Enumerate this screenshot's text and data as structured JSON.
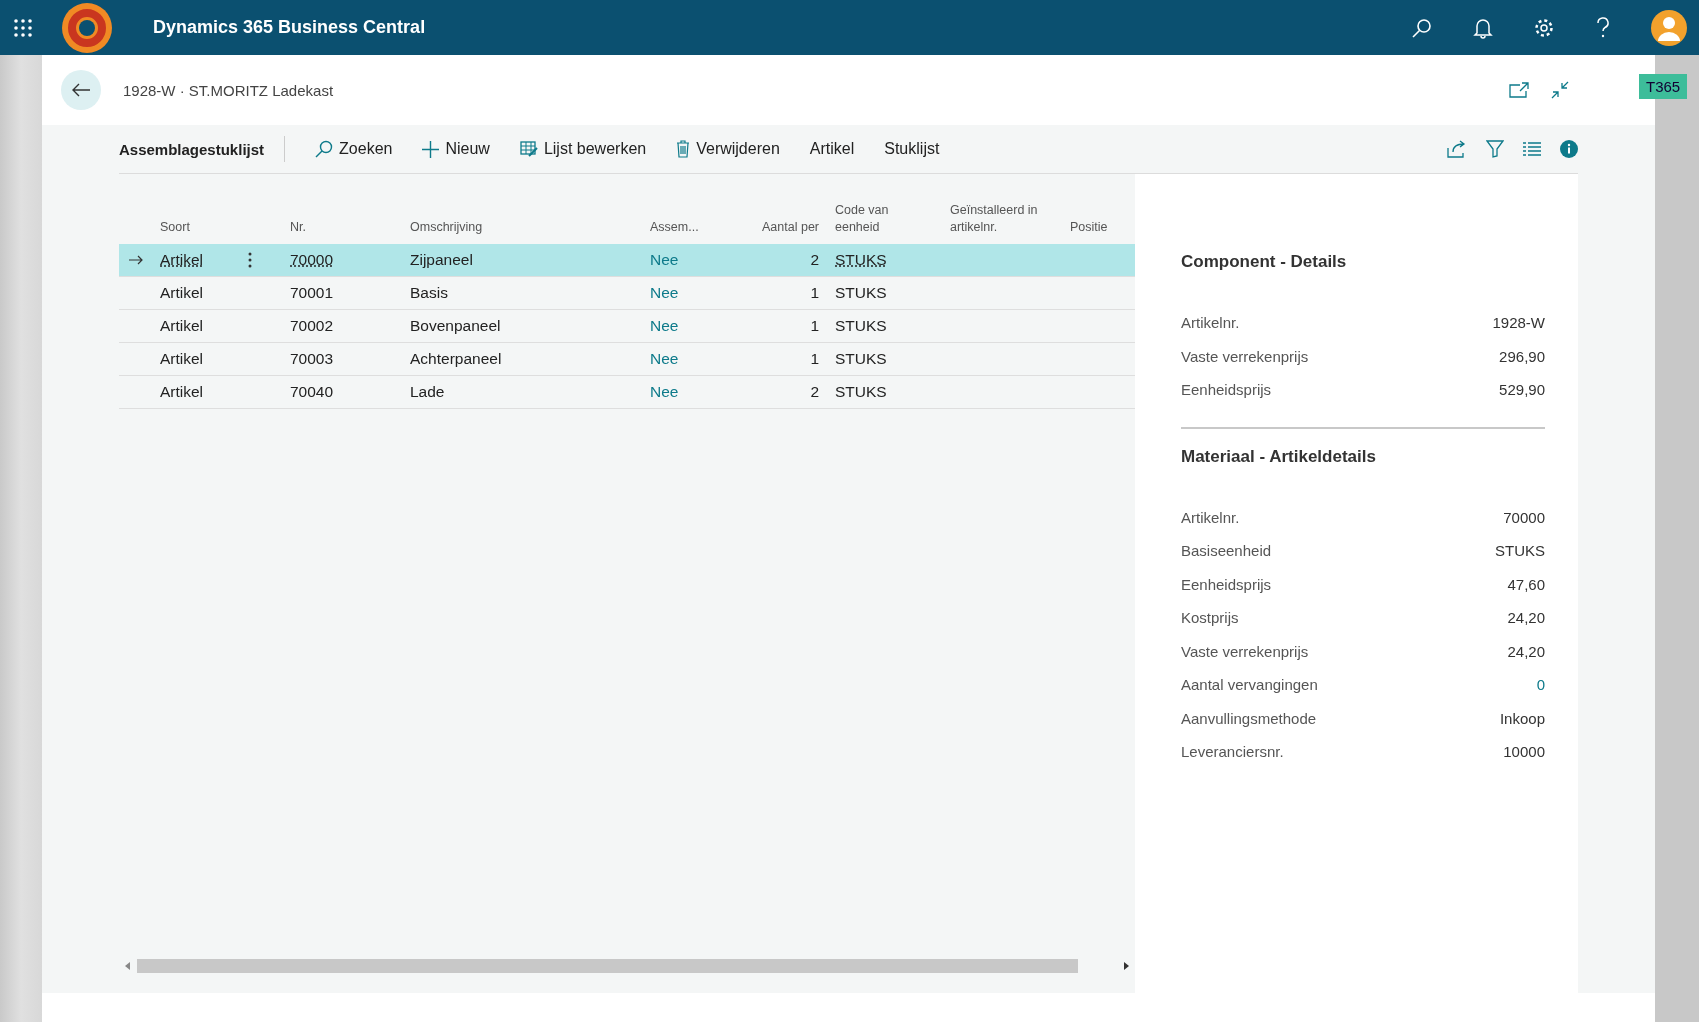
{
  "app": {
    "title": "Dynamics 365 Business Central"
  },
  "page": {
    "title": "1928-W · ST.MORITZ Ladekast"
  },
  "badge": "T365",
  "actions": [
    {
      "kind": "title",
      "label": "Assemblagestuklijst"
    },
    {
      "kind": "search",
      "label": "Zoeken"
    },
    {
      "kind": "new",
      "label": "Nieuw"
    },
    {
      "kind": "edit",
      "label": "Lijst bewerken"
    },
    {
      "kind": "delete",
      "label": "Verwijderen"
    },
    {
      "kind": "plain",
      "label": "Artikel"
    },
    {
      "kind": "plain",
      "label": "Stuklijst"
    }
  ],
  "table": {
    "columns": [
      {
        "label": "Soort",
        "kind": "lookup"
      },
      {
        "label": "Nr.",
        "kind": "lookup"
      },
      {
        "label": "Omschrijving",
        "kind": "text"
      },
      {
        "label": "Assem...",
        "kind": "flag"
      },
      {
        "label": "Aantal per",
        "kind": "number"
      },
      {
        "label": "Code van eenheid",
        "kind": "lookup"
      },
      {
        "label": "Geïnstalleerd in artikelnr.",
        "kind": "text"
      },
      {
        "label": "Positie",
        "kind": "text"
      }
    ],
    "rows": [
      {
        "selected": true,
        "cells": [
          "Artikel",
          "70000",
          "Zijpaneel",
          "Nee",
          "2",
          "STUKS",
          "",
          ""
        ]
      },
      {
        "selected": false,
        "cells": [
          "Artikel",
          "70001",
          "Basis",
          "Nee",
          "1",
          "STUKS",
          "",
          ""
        ]
      },
      {
        "selected": false,
        "cells": [
          "Artikel",
          "70002",
          "Bovenpaneel",
          "Nee",
          "1",
          "STUKS",
          "",
          ""
        ]
      },
      {
        "selected": false,
        "cells": [
          "Artikel",
          "70003",
          "Achterpaneel",
          "Nee",
          "1",
          "STUKS",
          "",
          ""
        ]
      },
      {
        "selected": false,
        "cells": [
          "Artikel",
          "70040",
          "Lade",
          "Nee",
          "2",
          "STUKS",
          "",
          ""
        ]
      }
    ]
  },
  "factbox": {
    "sections": [
      {
        "title": "Component - Details",
        "fields": [
          {
            "label": "Artikelnr.",
            "value": "1928-W",
            "kind": "plain"
          },
          {
            "label": "Vaste verrekenprijs",
            "value": "296,90",
            "kind": "plain"
          },
          {
            "label": "Eenheidsprijs",
            "value": "529,90",
            "kind": "plain"
          }
        ]
      },
      {
        "title": "Materiaal - Artikeldetails",
        "fields": [
          {
            "label": "Artikelnr.",
            "value": "70000",
            "kind": "plain"
          },
          {
            "label": "Basiseenheid",
            "value": "STUKS",
            "kind": "plain"
          },
          {
            "label": "Eenheidsprijs",
            "value": "47,60",
            "kind": "plain"
          },
          {
            "label": "Kostprijs",
            "value": "24,20",
            "kind": "plain"
          },
          {
            "label": "Vaste verrekenprijs",
            "value": "24,20",
            "kind": "plain"
          },
          {
            "label": "Aantal vervangingen",
            "value": "0",
            "kind": "link"
          },
          {
            "label": "Aanvullingsmethode",
            "value": "Inkoop",
            "kind": "plain"
          },
          {
            "label": "Leveranciersnr.",
            "value": "10000",
            "kind": "plain"
          }
        ]
      }
    ]
  }
}
